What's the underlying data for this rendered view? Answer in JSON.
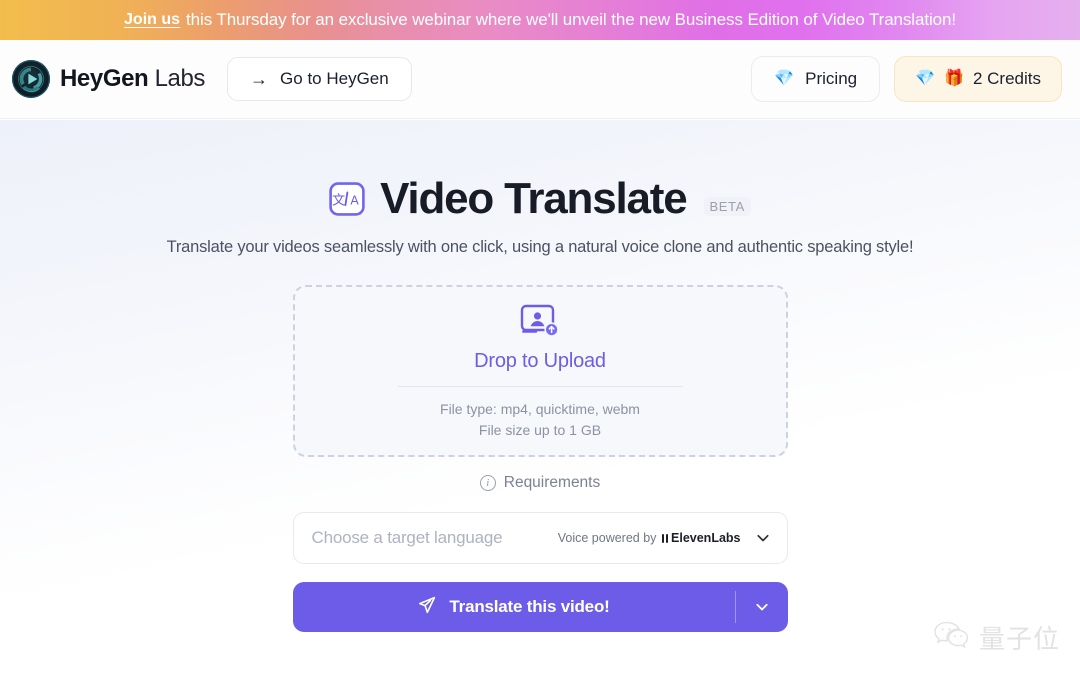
{
  "promo": {
    "link_label": "Join us",
    "message": "this Thursday for an exclusive webinar where we'll unveil the new Business Edition of Video Translation!"
  },
  "header": {
    "brand_bold": "HeyGen",
    "brand_light": "Labs",
    "goto_label": "Go to HeyGen",
    "goto_arrow": "→",
    "pricing_label": "Pricing",
    "pricing_emoji": "💎",
    "credits_label": "2 Credits",
    "credits_emoji_gem": "💎",
    "credits_emoji_gift": "🎁",
    "credits_count": "2"
  },
  "hero": {
    "title": "Video Translate",
    "badge": "BETA",
    "subtitle": "Translate your videos seamlessly with one click, using a natural voice clone and authentic speaking style!"
  },
  "dropzone": {
    "title": "Drop to Upload",
    "file_type_line": "File type: mp4, quicktime, webm",
    "file_size_line": "File size up to 1 GB"
  },
  "requirements": {
    "label": "Requirements",
    "icon_glyph": "i"
  },
  "language_select": {
    "placeholder": "Choose a target language",
    "value": "",
    "voice_prefix": "Voice powered by",
    "voice_brand": "ElevenLabs"
  },
  "cta": {
    "label": "Translate this video!"
  },
  "watermark": {
    "text": "量子位"
  },
  "colors": {
    "accent_purple": "#6c5ce7",
    "banner_start": "#f2bd4d",
    "banner_mid": "#e06fe6",
    "banner_end": "#e5b0ee",
    "credits_bg": "#fdf6e6",
    "page_bg_top": "#eef1fa"
  }
}
